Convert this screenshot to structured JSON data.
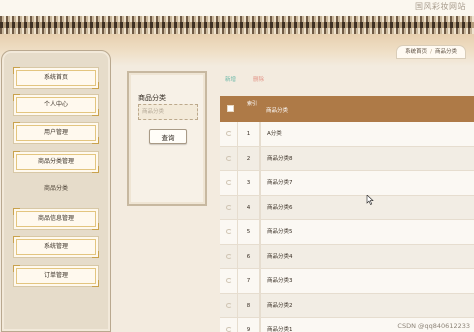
{
  "header": {
    "site_title": "国风彩妆网站"
  },
  "breadcrumb": {
    "home": "系统首页",
    "separator": "/",
    "current": "商品分类"
  },
  "sidebar": {
    "items": [
      {
        "label": "系统首页"
      },
      {
        "label": "个人中心"
      },
      {
        "label": "用户管理"
      },
      {
        "label": "商品分类管理"
      }
    ],
    "section_label": "商品分类",
    "items_lower": [
      {
        "label": "商品信息管理"
      },
      {
        "label": "系统管理"
      },
      {
        "label": "订单管理"
      }
    ]
  },
  "search": {
    "title": "商品分类",
    "placeholder": "商品分类",
    "button_label": "查询"
  },
  "actions": {
    "add_label": "新增",
    "delete_label": "删除"
  },
  "table": {
    "headers": {
      "no": "索引",
      "name": "商品分类"
    },
    "rows": [
      {
        "no": "1",
        "name": "A分类"
      },
      {
        "no": "2",
        "name": "商品分类8"
      },
      {
        "no": "3",
        "name": "商品分类7"
      },
      {
        "no": "4",
        "name": "商品分类6"
      },
      {
        "no": "5",
        "name": "商品分类5"
      },
      {
        "no": "6",
        "name": "商品分类4"
      },
      {
        "no": "7",
        "name": "商品分类3"
      },
      {
        "no": "8",
        "name": "商品分类2"
      },
      {
        "no": "9",
        "name": "商品分类1"
      }
    ]
  },
  "watermark": "CSDN @qq840612233",
  "colors": {
    "table_header": "#ae7a47",
    "add_link": "#6bb8a8",
    "delete_link": "#e29487",
    "background": "#f3ebdf"
  }
}
